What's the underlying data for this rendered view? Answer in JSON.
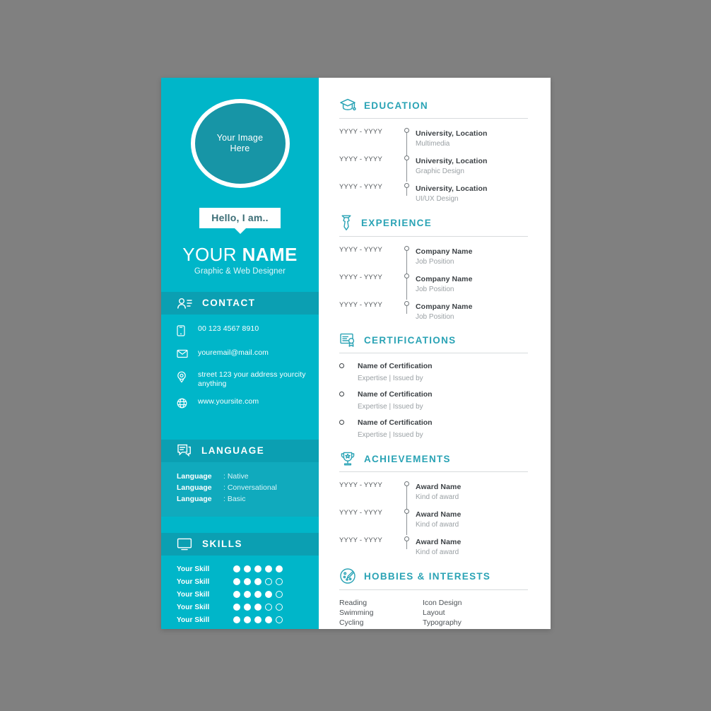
{
  "sidebar": {
    "photo_placeholder": "Your Image\nHere",
    "photo_line1": "Your Image",
    "photo_line2": "Here",
    "greeting": "Hello, I am..",
    "name_first": "YOUR ",
    "name_last": "NAME",
    "job_title": "Graphic & Web Designer",
    "contact": {
      "heading": "CONTACT",
      "icon": "contact-card-icon",
      "items": [
        {
          "icon": "phone-icon",
          "value": "00 123 4567 8910"
        },
        {
          "icon": "envelope-icon",
          "value": "youremail@mail.com"
        },
        {
          "icon": "location-pin-icon",
          "value": "street 123 your address yourcity anything"
        },
        {
          "icon": "globe-icon",
          "value": "www.yoursite.com"
        }
      ]
    },
    "language": {
      "heading": "LANGUAGE",
      "icon": "speech-bubble-icon",
      "items": [
        {
          "name": "Language",
          "level": ": Native"
        },
        {
          "name": "Language",
          "level": ": Conversational"
        },
        {
          "name": "Language",
          "level": ": Basic"
        }
      ]
    },
    "skills": {
      "heading": "SKILLS",
      "icon": "monitor-icon",
      "max": 5,
      "items": [
        {
          "name": "Your Skill",
          "rating": 5
        },
        {
          "name": "Your Skill",
          "rating": 3
        },
        {
          "name": "Your Skill",
          "rating": 4
        },
        {
          "name": "Your Skill",
          "rating": 3
        },
        {
          "name": "Your Skill",
          "rating": 4
        }
      ]
    }
  },
  "main": {
    "education": {
      "heading": "EDUCATION",
      "icon": "graduation-cap-icon",
      "items": [
        {
          "date": "YYYY - YYYY",
          "title": "University, Location",
          "sub": "Multimedia"
        },
        {
          "date": "YYYY - YYYY",
          "title": "University, Location",
          "sub": "Graphic Design"
        },
        {
          "date": "YYYY - YYYY",
          "title": "University, Location",
          "sub": "UI/UX Design"
        }
      ]
    },
    "experience": {
      "heading": "EXPERIENCE",
      "icon": "necktie-icon",
      "items": [
        {
          "date": "YYYY - YYYY",
          "title": "Company Name",
          "sub": "Job Position"
        },
        {
          "date": "YYYY - YYYY",
          "title": "Company Name",
          "sub": "Job Position"
        },
        {
          "date": "YYYY - YYYY",
          "title": "Company Name",
          "sub": "Job Position"
        }
      ]
    },
    "certifications": {
      "heading": "CERTIFICATIONS",
      "icon": "certificate-icon",
      "items": [
        {
          "title": "Name of Certification",
          "sub": "Expertise | Issued by"
        },
        {
          "title": "Name of Certification",
          "sub": "Expertise | Issued by"
        },
        {
          "title": "Name of Certification",
          "sub": "Expertise | Issued by"
        }
      ]
    },
    "achievements": {
      "heading": "ACHIEVEMENTS",
      "icon": "trophy-icon",
      "items": [
        {
          "date": "YYYY - YYYY",
          "title": "Award Name",
          "sub": "Kind of award"
        },
        {
          "date": "YYYY - YYYY",
          "title": "Award Name",
          "sub": "Kind of award"
        },
        {
          "date": "YYYY - YYYY",
          "title": "Award Name",
          "sub": "Kind of award"
        }
      ]
    },
    "hobbies": {
      "heading": "HOBBIES & INTERESTS",
      "icon": "palette-icon",
      "column_left": [
        "Reading",
        "Swimming",
        "Cycling"
      ],
      "column_right": [
        "Icon Design",
        "Layout",
        "Typography"
      ]
    }
  },
  "colors": {
    "sidebar_bg": "#00b6c9",
    "sidebar_head_bg": "#0b9fb2",
    "language_body_bg": "#10aabd",
    "photo_fill": "#1795a6",
    "accent_teal": "#2aa3b5",
    "page_bg": "#808080",
    "text_dark": "#3c4145",
    "text_muted": "#9aa0a4"
  }
}
